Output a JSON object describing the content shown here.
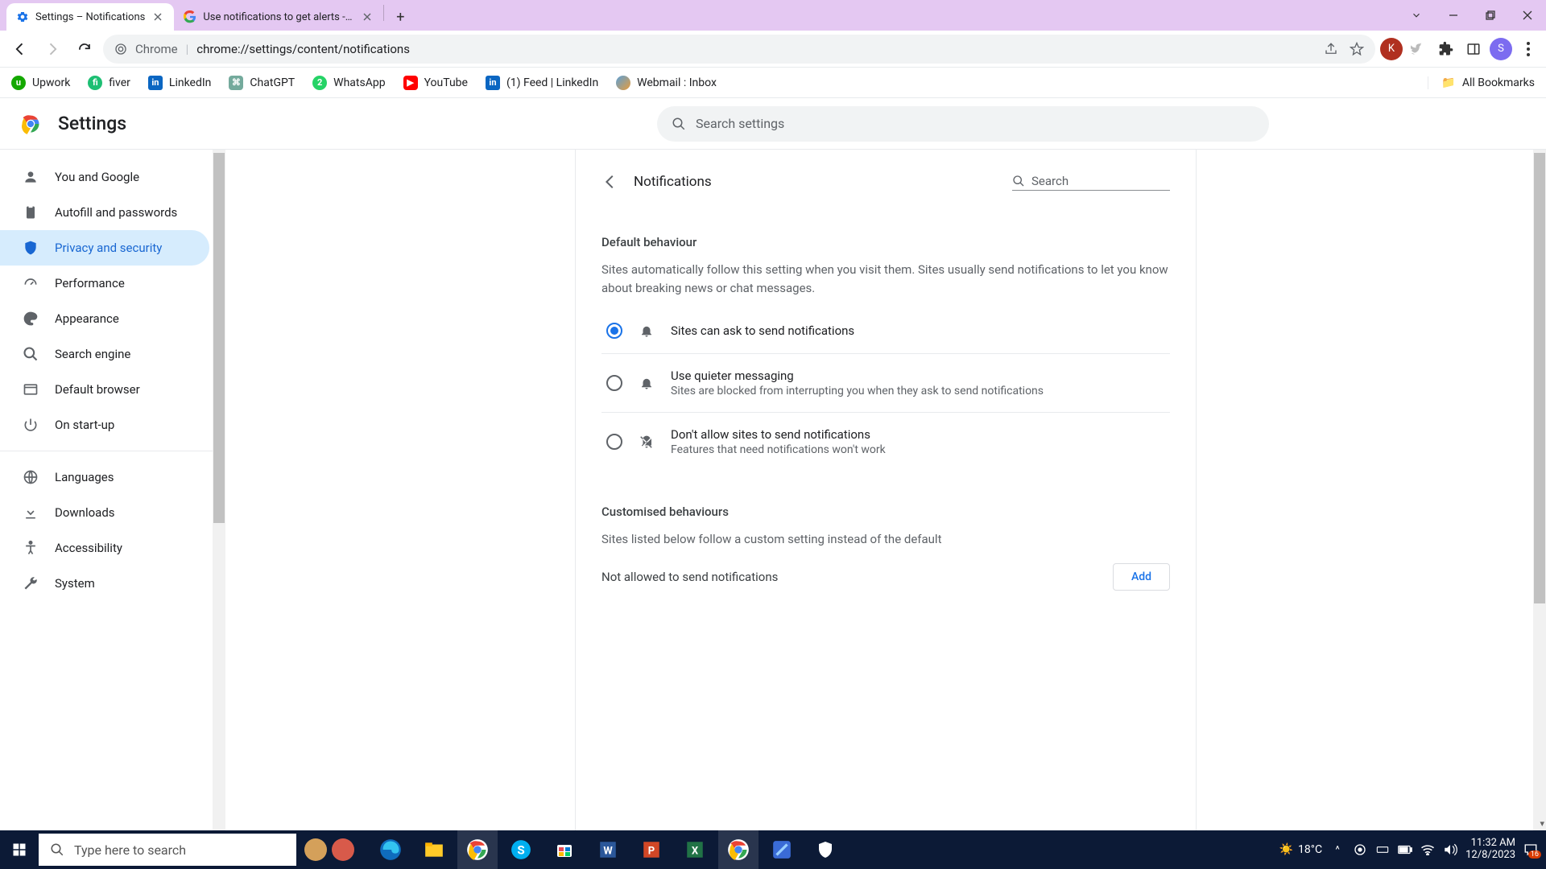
{
  "titlebar": {
    "tabs": [
      {
        "title": "Settings – Notifications",
        "active": true
      },
      {
        "title": "Use notifications to get alerts - G",
        "active": false
      }
    ]
  },
  "omnibox": {
    "scheme_label": "Chrome",
    "url": "chrome://settings/content/notifications"
  },
  "bookmarks": {
    "items": [
      {
        "label": "Upwork",
        "color": "#14a800"
      },
      {
        "label": "fiver",
        "color": "#1dbf73"
      },
      {
        "label": "LinkedIn",
        "color": "#0a66c2"
      },
      {
        "label": "ChatGPT",
        "color": "#74aa9c"
      },
      {
        "label": "WhatsApp",
        "color": "#25d366"
      },
      {
        "label": "YouTube",
        "color": "#ff0000"
      },
      {
        "label": "(1) Feed | LinkedIn",
        "color": "#0a66c2"
      },
      {
        "label": "Webmail : Inbox",
        "color": "#5aa0d8"
      }
    ],
    "all": "All Bookmarks"
  },
  "settings": {
    "app_title": "Settings",
    "search_placeholder": "Search settings",
    "sidebar": [
      {
        "label": "You and Google",
        "icon": "person"
      },
      {
        "label": "Autofill and passwords",
        "icon": "clipboard"
      },
      {
        "label": "Privacy and security",
        "icon": "shield",
        "selected": true
      },
      {
        "label": "Performance",
        "icon": "speed"
      },
      {
        "label": "Appearance",
        "icon": "palette"
      },
      {
        "label": "Search engine",
        "icon": "search"
      },
      {
        "label": "Default browser",
        "icon": "window"
      },
      {
        "label": "On start-up",
        "icon": "power"
      },
      {
        "label": "Languages",
        "icon": "globe"
      },
      {
        "label": "Downloads",
        "icon": "download"
      },
      {
        "label": "Accessibility",
        "icon": "accessibility"
      },
      {
        "label": "System",
        "icon": "wrench"
      }
    ],
    "content": {
      "page_title": "Notifications",
      "search_placeholder": "Search",
      "section1_title": "Default behaviour",
      "section1_desc": "Sites automatically follow this setting when you visit them. Sites usually send notifications to let you know about breaking news or chat messages.",
      "options": [
        {
          "label": "Sites can ask to send notifications",
          "sub": "",
          "checked": true,
          "icon": "bell"
        },
        {
          "label": "Use quieter messaging",
          "sub": "Sites are blocked from interrupting you when they ask to send notifications",
          "checked": false,
          "icon": "bell"
        },
        {
          "label": "Don't allow sites to send notifications",
          "sub": "Features that need notifications won't work",
          "checked": false,
          "icon": "bell-off"
        }
      ],
      "section2_title": "Customised behaviours",
      "section2_desc": "Sites listed below follow a custom setting instead of the default",
      "not_allowed_label": "Not allowed to send notifications",
      "add_label": "Add"
    }
  },
  "taskbar": {
    "search_placeholder": "Type here to search",
    "temp": "18°C",
    "time": "11:32 AM",
    "date": "12/8/2023",
    "notif_count": "16"
  }
}
